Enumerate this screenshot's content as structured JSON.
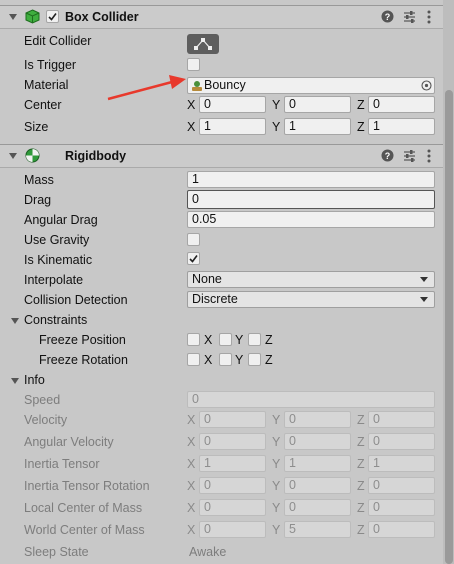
{
  "box_collider": {
    "title": "Box Collider",
    "edit_collider_label": "Edit Collider",
    "is_trigger_label": "Is Trigger",
    "material_label": "Material",
    "material_value": "Bouncy",
    "center_label": "Center",
    "center": {
      "x": "0",
      "y": "0",
      "z": "0"
    },
    "size_label": "Size",
    "size": {
      "x": "1",
      "y": "1",
      "z": "1"
    }
  },
  "rigidbody": {
    "title": "Rigidbody",
    "mass_label": "Mass",
    "mass": "1",
    "drag_label": "Drag",
    "drag": "0",
    "angular_drag_label": "Angular Drag",
    "angular_drag": "0.05",
    "use_gravity_label": "Use Gravity",
    "is_kinematic_label": "Is Kinematic",
    "interpolate_label": "Interpolate",
    "interpolate": "None",
    "collision_detection_label": "Collision Detection",
    "collision_detection": "Discrete",
    "constraints_label": "Constraints",
    "freeze_position_label": "Freeze Position",
    "freeze_rotation_label": "Freeze Rotation",
    "axis_x": "X",
    "axis_y": "Y",
    "axis_z": "Z"
  },
  "info": {
    "title": "Info",
    "speed_label": "Speed",
    "speed": "0",
    "velocity_label": "Velocity",
    "velocity": {
      "x": "0",
      "y": "0",
      "z": "0"
    },
    "angular_velocity_label": "Angular Velocity",
    "angular_velocity": {
      "x": "0",
      "y": "0",
      "z": "0"
    },
    "inertia_tensor_label": "Inertia Tensor",
    "inertia_tensor": {
      "x": "1",
      "y": "1",
      "z": "1"
    },
    "inertia_tensor_rotation_label": "Inertia Tensor Rotation",
    "inertia_tensor_rotation": {
      "x": "0",
      "y": "0",
      "z": "0"
    },
    "local_center_of_mass_label": "Local Center of Mass",
    "local_center_of_mass": {
      "x": "0",
      "y": "0",
      "z": "0"
    },
    "world_center_of_mass_label": "World Center of Mass",
    "world_center_of_mass": {
      "x": "0",
      "y": "5",
      "z": "0"
    },
    "sleep_state_label": "Sleep State",
    "sleep_state": "Awake"
  },
  "colors": {
    "annotation_arrow": "#e8392c",
    "panel": "#c8c8c8"
  },
  "icons": [
    "box-collider-icon",
    "rigidbody-icon",
    "help-icon",
    "preset-icon",
    "context-menu-icon",
    "edit-collider-icon",
    "physic-material-icon",
    "object-picker-icon",
    "checkmark-icon",
    "dropdown-arrow-icon",
    "foldout-arrow-icon",
    "annotation-arrow"
  ]
}
